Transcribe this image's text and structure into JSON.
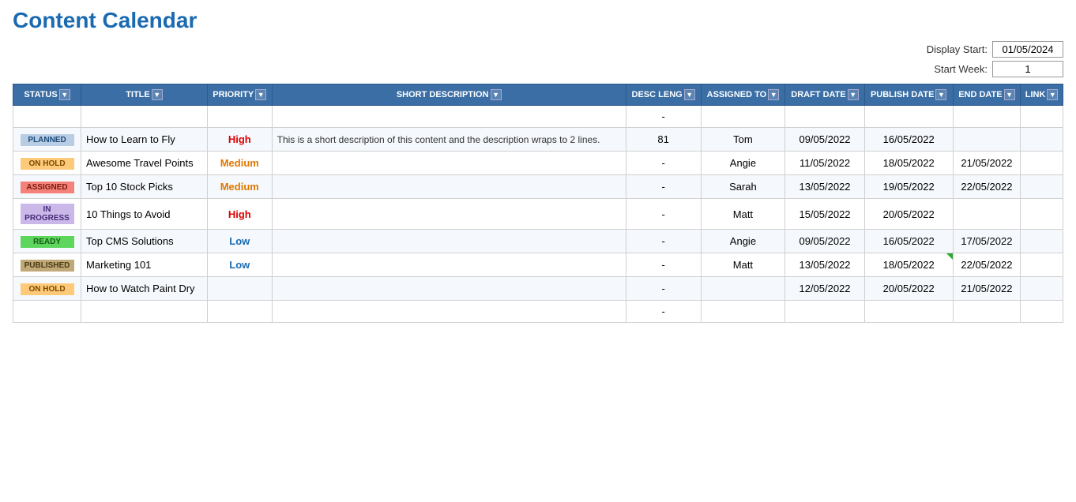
{
  "page": {
    "title": "Content Calendar"
  },
  "controls": {
    "display_start_label": "Display Start:",
    "display_start_value": "01/05/2024",
    "start_week_label": "Start Week:",
    "start_week_value": "1"
  },
  "table": {
    "columns": [
      {
        "id": "status",
        "label": "STATUS",
        "has_dropdown": true
      },
      {
        "id": "title",
        "label": "TITLE",
        "has_dropdown": true
      },
      {
        "id": "priority",
        "label": "PRIORITY",
        "has_dropdown": true
      },
      {
        "id": "short_description",
        "label": "SHORT DESCRIPTION",
        "has_dropdown": true
      },
      {
        "id": "desc_leng",
        "label": "DESC LENG",
        "has_dropdown": true
      },
      {
        "id": "assigned_to",
        "label": "ASSIGNED TO",
        "has_dropdown": true
      },
      {
        "id": "draft_date",
        "label": "DRAFT DATE",
        "has_dropdown": true
      },
      {
        "id": "publish_date",
        "label": "PUBLISH DATE",
        "has_dropdown": true
      },
      {
        "id": "end_date",
        "label": "END DATE",
        "has_dropdown": true
      },
      {
        "id": "link",
        "label": "LINK",
        "has_dropdown": true
      }
    ],
    "rows": [
      {
        "id": "empty-top",
        "status": "",
        "status_class": "",
        "title": "",
        "priority": "",
        "priority_class": "",
        "short_description": "",
        "desc_leng": "-",
        "assigned_to": "",
        "draft_date": "",
        "publish_date": "",
        "end_date": "",
        "link": "",
        "is_empty": true
      },
      {
        "id": "row-1",
        "status": "PLANNED",
        "status_class": "status-planned",
        "title": "How to Learn to Fly",
        "priority": "High",
        "priority_class": "priority-high",
        "short_description": "This is a short description of this content and the description wraps to 2 lines.",
        "desc_leng": "81",
        "assigned_to": "Tom",
        "draft_date": "09/05/2022",
        "publish_date": "16/05/2022",
        "end_date": "",
        "link": "",
        "is_empty": false
      },
      {
        "id": "row-2",
        "status": "ON HOLD",
        "status_class": "status-on-hold",
        "title": "Awesome Travel Points",
        "priority": "Medium",
        "priority_class": "priority-medium",
        "short_description": "",
        "desc_leng": "-",
        "assigned_to": "Angie",
        "draft_date": "11/05/2022",
        "publish_date": "18/05/2022",
        "end_date": "21/05/2022",
        "link": "",
        "is_empty": false
      },
      {
        "id": "row-3",
        "status": "ASSIGNED",
        "status_class": "status-assigned",
        "title": "Top 10 Stock Picks",
        "priority": "Medium",
        "priority_class": "priority-medium",
        "short_description": "",
        "desc_leng": "-",
        "assigned_to": "Sarah",
        "draft_date": "13/05/2022",
        "publish_date": "19/05/2022",
        "end_date": "22/05/2022",
        "link": "",
        "is_empty": false
      },
      {
        "id": "row-4",
        "status": "IN PROGRESS",
        "status_class": "status-in-progress",
        "title": "10 Things to Avoid",
        "priority": "High",
        "priority_class": "priority-high",
        "short_description": "",
        "desc_leng": "-",
        "assigned_to": "Matt",
        "draft_date": "15/05/2022",
        "publish_date": "20/05/2022",
        "end_date": "",
        "link": "",
        "is_empty": false
      },
      {
        "id": "row-5",
        "status": "READY",
        "status_class": "status-ready",
        "title": "Top CMS Solutions",
        "priority": "Low",
        "priority_class": "priority-low",
        "short_description": "",
        "desc_leng": "-",
        "assigned_to": "Angie",
        "draft_date": "09/05/2022",
        "publish_date": "16/05/2022",
        "end_date": "17/05/2022",
        "link": "",
        "is_empty": false
      },
      {
        "id": "row-6",
        "status": "PUBLISHED",
        "status_class": "status-published",
        "title": "Marketing 101",
        "priority": "Low",
        "priority_class": "priority-low",
        "short_description": "",
        "desc_leng": "-",
        "assigned_to": "Matt",
        "draft_date": "13/05/2022",
        "publish_date": "18/05/2022",
        "end_date": "22/05/2022",
        "link": "",
        "is_empty": false,
        "publish_date_has_corner": true
      },
      {
        "id": "row-7",
        "status": "ON HOLD",
        "status_class": "status-on-hold",
        "title": "How to Watch Paint Dry",
        "priority": "",
        "priority_class": "",
        "short_description": "",
        "desc_leng": "-",
        "assigned_to": "",
        "draft_date": "12/05/2022",
        "publish_date": "20/05/2022",
        "end_date": "21/05/2022",
        "link": "",
        "is_empty": false
      },
      {
        "id": "empty-bottom",
        "status": "",
        "status_class": "",
        "title": "",
        "priority": "",
        "priority_class": "",
        "short_description": "",
        "desc_leng": "-",
        "assigned_to": "",
        "draft_date": "",
        "publish_date": "",
        "end_date": "",
        "link": "",
        "is_empty": true
      }
    ]
  }
}
